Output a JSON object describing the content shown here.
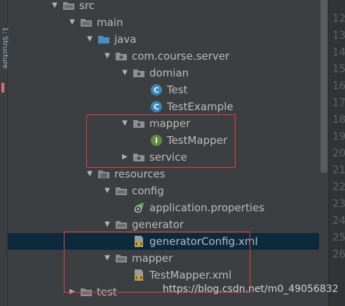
{
  "tool_window": {
    "side_tab_label": "1: Structure"
  },
  "tree": [
    {
      "label": "src",
      "icon": "folder-icon",
      "expanded": true
    },
    {
      "label": "main",
      "icon": "folder-icon",
      "expanded": true
    },
    {
      "label": "java",
      "icon": "source-root-folder-icon",
      "expanded": true
    },
    {
      "label": "com.course.server",
      "icon": "package-icon",
      "expanded": true
    },
    {
      "label": "domian",
      "icon": "package-icon",
      "expanded": true
    },
    {
      "label": "Test",
      "icon": "class-icon"
    },
    {
      "label": "TestExample",
      "icon": "class-icon"
    },
    {
      "label": "mapper",
      "icon": "package-icon",
      "expanded": true
    },
    {
      "label": "TestMapper",
      "icon": "interface-icon"
    },
    {
      "label": "service",
      "icon": "package-icon",
      "expanded": false
    },
    {
      "label": "resources",
      "icon": "resources-folder-icon",
      "expanded": true
    },
    {
      "label": "config",
      "icon": "folder-icon",
      "expanded": true
    },
    {
      "label": "application.properties",
      "icon": "spring-properties-icon"
    },
    {
      "label": "generator",
      "icon": "folder-icon",
      "expanded": true
    },
    {
      "label": "generatorConfig.xml",
      "icon": "xml-file-icon",
      "selected": true
    },
    {
      "label": "mapper",
      "icon": "folder-icon",
      "expanded": true
    },
    {
      "label": "TestMapper.xml",
      "icon": "xml-file-icon"
    },
    {
      "label": "test",
      "icon": "folder-icon",
      "expanded": false
    }
  ],
  "gutter": {
    "line_numbers": [
      "12",
      "13",
      "14",
      "15",
      "16",
      "17",
      "18",
      "19",
      "20",
      "21",
      "22",
      "23",
      "24",
      "25",
      "26"
    ]
  },
  "watermark": "https://blog.csdn.net/m0_49056832",
  "colors": {
    "background": "#3c3f41",
    "selection": "#0d293e",
    "text": "#bbbbbb",
    "highlight_box": "#e83e3e",
    "class_icon": "#3b87b5",
    "interface_icon": "#5f8c3e",
    "folder": "#8d9194",
    "source_folder": "#4a8fbf",
    "xml_icon": "#c8a23a",
    "spring_leaf": "#6aa84f"
  }
}
